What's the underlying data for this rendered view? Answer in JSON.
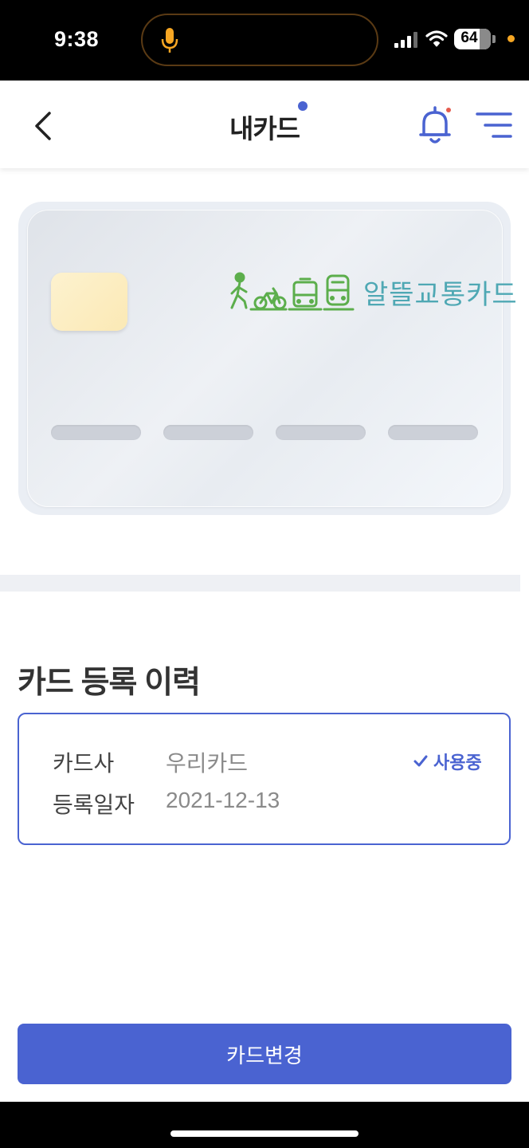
{
  "status_bar": {
    "time": "9:38",
    "battery_level": "64",
    "icons": [
      "mic-icon",
      "cellular-signal-icon",
      "wifi-icon",
      "battery-icon"
    ]
  },
  "header": {
    "title": "내카드",
    "icons": [
      "back-chevron-icon",
      "bell-icon",
      "menu-icon"
    ],
    "accent_color": "#4a63d1"
  },
  "card": {
    "logo_text": "알뜰교통카드",
    "logo_icons": [
      "walking-person-icon",
      "bicycle-icon",
      "bus-icon",
      "train-icon"
    ],
    "logo_colors": {
      "icons": "#5cae4c",
      "text": "#4fa8b4"
    }
  },
  "history": {
    "section_title": "카드 등록 이력",
    "company_label": "카드사",
    "company_value": "우리카드",
    "date_label": "등록일자",
    "date_value": "2021-12-13",
    "status": "사용중"
  },
  "actions": {
    "change_card_label": "카드변경"
  }
}
